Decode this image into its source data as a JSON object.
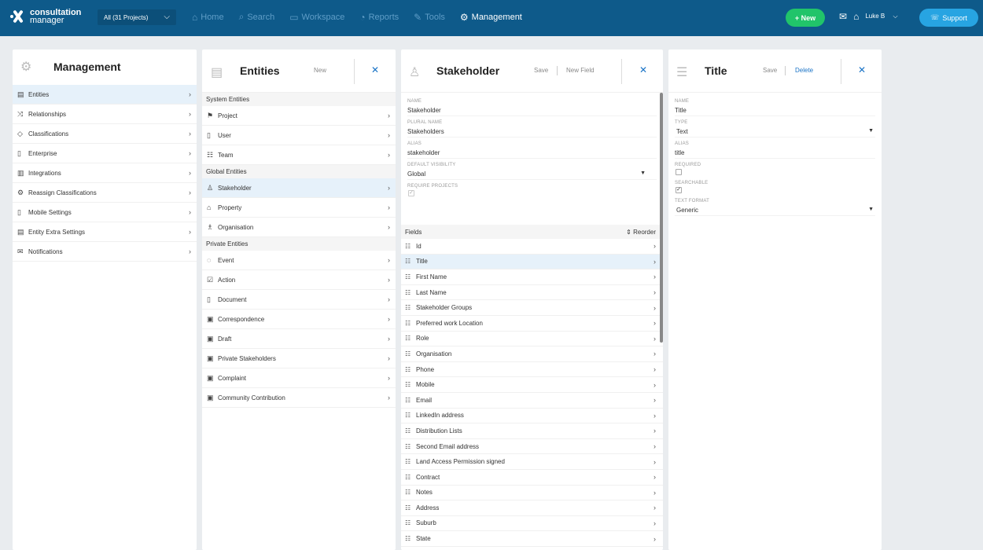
{
  "header": {
    "logo_top": "consultation",
    "logo_bottom": "manager",
    "project_select": "All (31 Projects)",
    "nav": [
      {
        "label": "Home",
        "icon": "home-icon",
        "glyph": "⌂",
        "active": false
      },
      {
        "label": "Search",
        "icon": "search-icon",
        "glyph": "⌕",
        "active": false
      },
      {
        "label": "Workspace",
        "icon": "workspace-icon",
        "glyph": "▭",
        "active": false
      },
      {
        "label": "Reports",
        "icon": "reports-icon",
        "glyph": "◔",
        "active": false
      },
      {
        "label": "Tools",
        "icon": "tools-icon",
        "glyph": "✎",
        "active": false
      },
      {
        "label": "Management",
        "icon": "gear-icon",
        "glyph": "⚙",
        "active": true
      }
    ],
    "new_button": "+ New",
    "user_name": "Luke B",
    "support_button": "Support"
  },
  "management": {
    "title": "Management",
    "items": [
      {
        "label": "Entities",
        "glyph": "▤",
        "selected": true
      },
      {
        "label": "Relationships",
        "glyph": "⤨",
        "selected": false
      },
      {
        "label": "Classifications",
        "glyph": "◇",
        "selected": false
      },
      {
        "label": "Enterprise",
        "glyph": "▯",
        "selected": false
      },
      {
        "label": "Integrations",
        "glyph": "▥",
        "selected": false
      },
      {
        "label": "Reassign Classifications",
        "glyph": "⚙",
        "selected": false
      },
      {
        "label": "Mobile Settings",
        "glyph": "▯",
        "selected": false
      },
      {
        "label": "Entity Extra Settings",
        "glyph": "▤",
        "selected": false
      },
      {
        "label": "Notifications",
        "glyph": "✉",
        "selected": false
      }
    ]
  },
  "entities": {
    "title": "Entities",
    "new_label": "New",
    "sections": [
      {
        "title": "System Entities",
        "items": [
          {
            "label": "Project",
            "glyph": "⚑",
            "selected": false
          },
          {
            "label": "User",
            "glyph": "▯",
            "selected": false
          },
          {
            "label": "Team",
            "glyph": "☷",
            "selected": false
          }
        ]
      },
      {
        "title": "Global Entities",
        "items": [
          {
            "label": "Stakeholder",
            "glyph": "♙",
            "selected": true
          },
          {
            "label": "Property",
            "glyph": "⌂",
            "selected": false
          },
          {
            "label": "Organisation",
            "glyph": "♗",
            "selected": false
          }
        ]
      },
      {
        "title": "Private Entities",
        "items": [
          {
            "label": "Event",
            "glyph": "◌",
            "selected": false
          },
          {
            "label": "Action",
            "glyph": "☑",
            "selected": false
          },
          {
            "label": "Document",
            "glyph": "▯",
            "selected": false
          },
          {
            "label": "Correspondence",
            "glyph": "▣",
            "selected": false
          },
          {
            "label": "Draft",
            "glyph": "▣",
            "selected": false
          },
          {
            "label": "Private Stakeholders",
            "glyph": "▣",
            "selected": false
          },
          {
            "label": "Complaint",
            "glyph": "▣",
            "selected": false
          },
          {
            "label": "Community Contribution",
            "glyph": "▣",
            "selected": false
          }
        ]
      }
    ]
  },
  "stakeholder": {
    "title": "Stakeholder",
    "save_label": "Save",
    "new_field_label": "New Field",
    "name_label": "NAME",
    "name_value": "Stakeholder",
    "plural_label": "PLURAL NAME",
    "plural_value": "Stakeholders",
    "alias_label": "ALIAS",
    "alias_value": "stakeholder",
    "visibility_label": "DEFAULT VISIBILITY",
    "visibility_value": "Global",
    "require_projects_label": "REQUIRE PROJECTS",
    "require_projects_checked": true,
    "fields_heading": "Fields",
    "reorder_label": "Reorder",
    "fields": [
      "Id",
      "Title",
      "First Name",
      "Last Name",
      "Stakeholder Groups",
      "Preferred work Location",
      "Role",
      "Organisation",
      "Phone",
      "Mobile",
      "Email",
      "LinkedIn address",
      "Distribution Lists",
      "Second Email address",
      "Land Access Permission signed",
      "Contract",
      "Notes",
      "Address",
      "Suburb",
      "State"
    ],
    "selected_field": "Title"
  },
  "title_panel": {
    "title": "Title",
    "save_label": "Save",
    "delete_label": "Delete",
    "name_label": "NAME",
    "name_value": "Title",
    "type_label": "TYPE",
    "type_value": "Text",
    "alias_label": "ALIAS",
    "alias_value": "title",
    "required_label": "REQUIRED",
    "required_checked": false,
    "searchable_label": "SEARCHABLE",
    "searchable_checked": true,
    "text_format_label": "TEXT FORMAT",
    "text_format_value": "Generic"
  },
  "colors": {
    "topbar": "#0e5a8a",
    "new_button": "#21c46a",
    "support_button": "#27a4e2",
    "selected_row": "#e6f1fa",
    "accent": "#1a73c6"
  }
}
